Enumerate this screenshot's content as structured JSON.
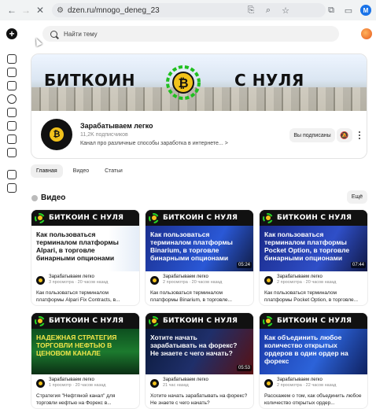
{
  "browser": {
    "url": "dzen.ru/mnogo_deneg_23",
    "profile_initial": "M"
  },
  "search": {
    "placeholder": "Найти тему"
  },
  "channel": {
    "banner_left": "БИТКОИН",
    "banner_right": "С НУЛЯ",
    "logo_symbol": "₿",
    "name": "Зарабатываем легко",
    "subscribers": "11,2K подписчиков",
    "description": "Канал про различные способы заработка в интернете... >",
    "subscribed_label": "Вы подписаны"
  },
  "tabs": [
    "Главная",
    "Видео",
    "Статьи"
  ],
  "section": {
    "title": "Видео",
    "more_label": "Ещё"
  },
  "videos": [
    {
      "header": "БИТКОИН С НУЛЯ",
      "thumb_text": "Как пользоваться терминалом платформы Alpari, в торговле бинарными опционами",
      "duration": "",
      "channel": "Зарабатываем легко",
      "stats": "3 просмотра · 20 часов назад",
      "title": "Как пользоваться терминалом платформы Alpari Fix Contracts, в..."
    },
    {
      "header": "БИТКОИН С НУЛЯ",
      "thumb_text": "Как пользоваться терминалом платформы Binarium, в торговле бинарными опционами",
      "duration": "05:24",
      "channel": "Зарабатываем легко",
      "stats": "2 просмотра · 20 часов назад",
      "title": "Как пользоваться терминалом платформы Binarium, в торговле..."
    },
    {
      "header": "БИТКОИН С НУЛЯ",
      "thumb_text": "Как пользоваться терминалом платформы Pocket Option, в торговле бинарными опционами",
      "duration": "07:44",
      "channel": "Зарабатываем легко",
      "stats": "2 просмотра · 20 часов назад",
      "title": "Как пользоваться терминалом платформы Pocket Option, в торговле..."
    },
    {
      "header": "БИТКОИН С НУЛЯ",
      "thumb_text": "НАДЕЖНАЯ СТРАТЕГИЯ ТОРГОВЛИ НЕФТЬЮ В ЦЕНОВОМ КАНАЛЕ",
      "duration": "",
      "channel": "Зарабатываем легко",
      "stats": "1 просмотр · 20 часов назад",
      "title": "Стратегия \"Нефтяной канал\" для торговли нефтью на Форекс в..."
    },
    {
      "header": "БИТКОИН С НУЛЯ",
      "thumb_text": "Хотите начать зарабатывать на форекс? Не знаете с чего начать?",
      "duration": "05:53",
      "channel": "Зарабатываем легко",
      "stats": "21 час назад",
      "title": "Хотите начать зарабатывать на форекс? Не знаете с чего начать?"
    },
    {
      "header": "БИТКОИН С НУЛЯ",
      "thumb_text": "Как объединить любое количество открытых ордеров в один ордер на форекс",
      "duration": "",
      "channel": "Зарабатываем легко",
      "stats": "2 просмотра · 22 часов назад",
      "title": "Расскажем о том, как объединить любое количество открытых ордер..."
    }
  ]
}
